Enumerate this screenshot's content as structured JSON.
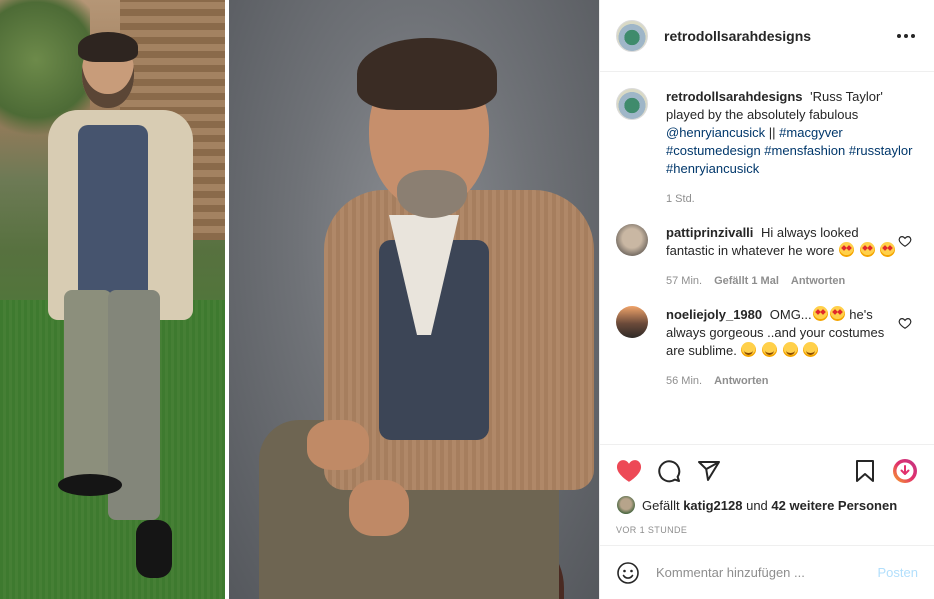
{
  "post": {
    "username": "retrodollsarahdesigns",
    "caption": {
      "username": "retrodollsarahdesigns",
      "text": "'Russ Taylor' played by the absolutely fabulous",
      "mention": "@henryiancusick",
      "separator": " || ",
      "tags": [
        "#macgyver",
        "#costumedesign",
        "#mensfashion",
        "#russtaylor",
        "#henryiancusick"
      ],
      "time": "1 Std."
    },
    "comments": [
      {
        "username": "pattiprinzivalli",
        "text": "Hi always looked fantastic in whatever he wore",
        "time": "57 Min.",
        "likes": "Gefällt 1 Mal",
        "reply": "Antworten"
      },
      {
        "username": "noeliejoly_1980",
        "text_a": "OMG...",
        "text_b": " he's always gorgeous ..and your costumes are sublime.",
        "time": "56 Min.",
        "reply": "Antworten"
      }
    ],
    "liked_by": {
      "prefix": "Gefällt",
      "user": "katig2128",
      "middle": "und",
      "others": "42 weitere Personen"
    },
    "date": "VOR 1 STUNDE",
    "add_comment": {
      "placeholder": "Kommentar hinzufügen ...",
      "post_label": "Posten"
    }
  },
  "colors": {
    "like_red": "#ed4956",
    "link_blue": "#00376b",
    "post_disabled": "#b2dffc",
    "muted": "#8e8e8e"
  },
  "icons": [
    "more-icon",
    "heart-icon",
    "comment-icon",
    "share-icon",
    "bookmark-icon",
    "reels-icon",
    "emoji-icon",
    "small-heart-icon"
  ]
}
